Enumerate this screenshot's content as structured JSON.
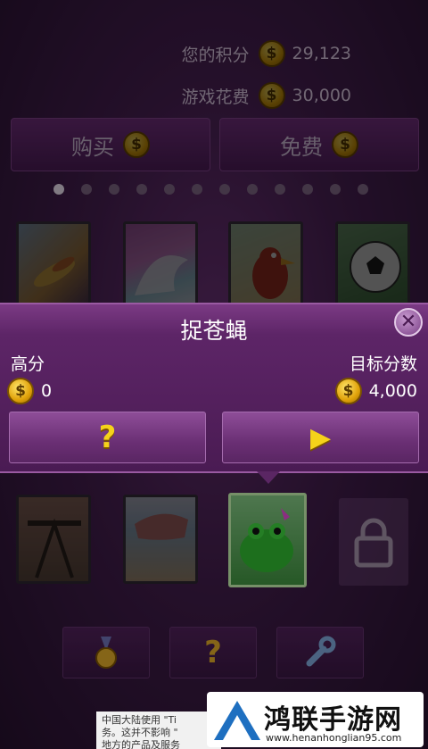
{
  "stats": {
    "points_label": "您的积分",
    "points_value": "29,123",
    "cost_label": "游戏花费",
    "cost_value": "30,000",
    "coin_symbol": "$"
  },
  "top_buttons": {
    "buy": "购买",
    "free": "免费"
  },
  "pager": {
    "total": 12,
    "active_index": 0
  },
  "panel": {
    "title": "捉苍蝇",
    "close_symbol": "✕",
    "high_score_label": "高分",
    "high_score_value": "0",
    "target_label": "目标分数",
    "target_value": "4,000",
    "help_symbol": "?",
    "play_symbol": "▶"
  },
  "colors": {
    "coin": "#f2c21a",
    "panel": "#5d2567",
    "selected_border": "#bfe8a8"
  },
  "watermark": {
    "title": "鸿联手游网",
    "url": "www.henanhonglian95.com"
  },
  "ad_text": [
    "中国大陆使用 \"Ti",
    "务。这并不影响 \"",
    "地方的产品及服务"
  ]
}
